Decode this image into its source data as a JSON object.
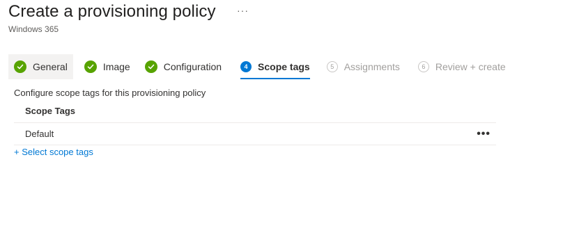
{
  "header": {
    "title": "Create a provisioning policy",
    "more_icon": "···",
    "subtitle": "Windows 365"
  },
  "wizard": {
    "steps": [
      {
        "label": "General",
        "state": "completed",
        "marker": ""
      },
      {
        "label": "Image",
        "state": "completed",
        "marker": ""
      },
      {
        "label": "Configuration",
        "state": "completed",
        "marker": ""
      },
      {
        "label": "Scope tags",
        "state": "active",
        "marker": "4"
      },
      {
        "label": "Assignments",
        "state": "pending",
        "marker": "5"
      },
      {
        "label": "Review + create",
        "state": "pending",
        "marker": "6"
      }
    ]
  },
  "content": {
    "description": "Configure scope tags for this provisioning policy",
    "table": {
      "header": "Scope Tags",
      "rows": [
        {
          "name": "Default",
          "more": "•••"
        }
      ]
    },
    "add_link": "+ Select scope tags"
  },
  "colors": {
    "accent": "#0078d4",
    "success": "#57a300",
    "text": "#323130",
    "muted": "#a19f9d",
    "divider": "#edebe9"
  }
}
